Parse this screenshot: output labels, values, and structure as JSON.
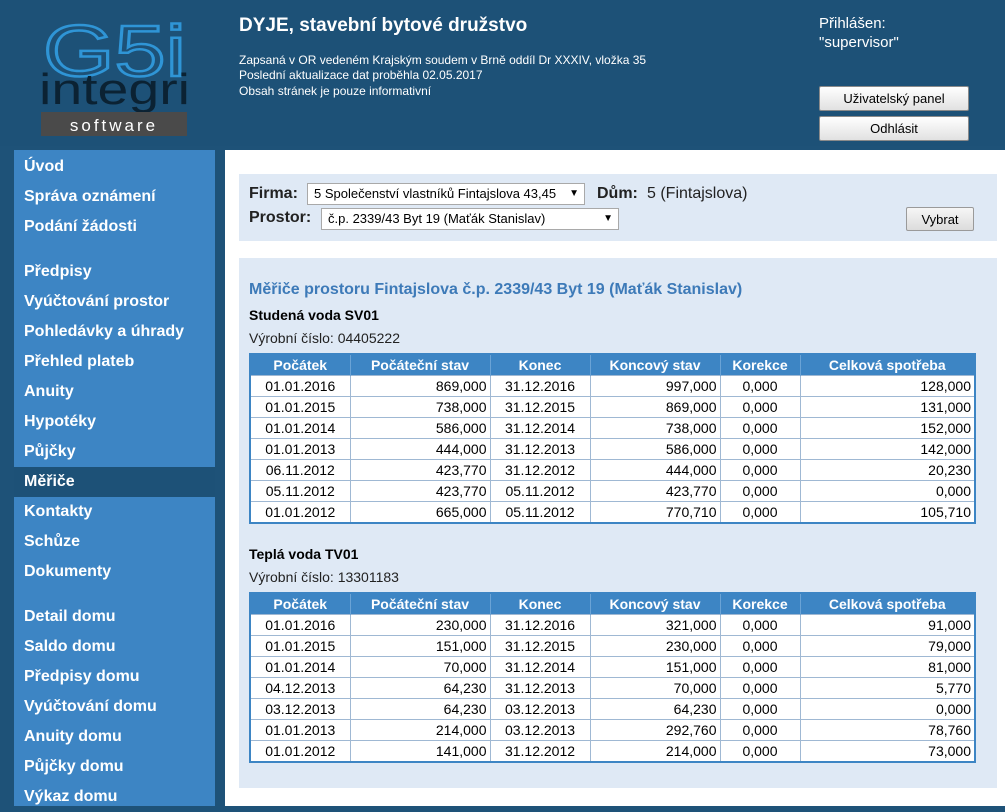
{
  "header": {
    "title": "DYJE, stavební bytové družstvo",
    "lines": [
      "Zapsaná v OR vedeném Krajským soudem v Brně oddíl Dr XXXIV, vložka 35",
      "Poslední aktualizace dat proběhla 02.05.2017",
      "Obsah stránek je pouze informativní"
    ],
    "login_label": "Přihlášen:",
    "login_user": "\"supervisor\"",
    "user_panel_button": "Uživatelský panel",
    "logout_button": "Odhlásit"
  },
  "logo": {
    "main": "G5i",
    "sub": "integri",
    "tag": "software"
  },
  "nav": {
    "items": [
      "Úvod",
      "Správa oznámení",
      "Podání žádosti",
      "Předpisy",
      "Vyúčtování prostor",
      "Pohledávky a úhrady",
      "Přehled plateb",
      "Anuity",
      "Hypotéky",
      "Půjčky",
      "Měřiče",
      "Kontakty",
      "Schůze",
      "Dokumenty",
      "Detail domu",
      "Saldo domu",
      "Předpisy domu",
      "Vyúčtování domu",
      "Anuity domu",
      "Půjčky domu",
      "Výkaz domu"
    ],
    "active": "Měřiče"
  },
  "filter": {
    "firm_label": "Firma:",
    "firm_value": "5 Společenství vlastníků Fintajslova 43,45",
    "house_label": "Dům:",
    "house_value": "5 (Fintajslova)",
    "space_label": "Prostor:",
    "space_value": "č.p. 2339/43 Byt 19 (Maťák Stanislav)",
    "select_button": "Vybrat"
  },
  "meters": {
    "title": "Měřiče prostoru Fintajslova č.p. 2339/43 Byt 19 (Maťák Stanislav)",
    "columns": [
      "Počátek",
      "Počáteční stav",
      "Konec",
      "Koncový stav",
      "Korekce",
      "Celková spotřeba"
    ],
    "list": [
      {
        "name": "Studená voda SV01",
        "serial": "Výrobní číslo: 04405222",
        "rows": [
          [
            "01.01.2016",
            "869,000",
            "31.12.2016",
            "997,000",
            "0,000",
            "128,000"
          ],
          [
            "01.01.2015",
            "738,000",
            "31.12.2015",
            "869,000",
            "0,000",
            "131,000"
          ],
          [
            "01.01.2014",
            "586,000",
            "31.12.2014",
            "738,000",
            "0,000",
            "152,000"
          ],
          [
            "01.01.2013",
            "444,000",
            "31.12.2013",
            "586,000",
            "0,000",
            "142,000"
          ],
          [
            "06.11.2012",
            "423,770",
            "31.12.2012",
            "444,000",
            "0,000",
            "20,230"
          ],
          [
            "05.11.2012",
            "423,770",
            "05.11.2012",
            "423,770",
            "0,000",
            "0,000"
          ],
          [
            "01.01.2012",
            "665,000",
            "05.11.2012",
            "770,710",
            "0,000",
            "105,710"
          ]
        ]
      },
      {
        "name": "Teplá voda TV01",
        "serial": "Výrobní číslo: 13301183",
        "rows": [
          [
            "01.01.2016",
            "230,000",
            "31.12.2016",
            "321,000",
            "0,000",
            "91,000"
          ],
          [
            "01.01.2015",
            "151,000",
            "31.12.2015",
            "230,000",
            "0,000",
            "79,000"
          ],
          [
            "01.01.2014",
            "70,000",
            "31.12.2014",
            "151,000",
            "0,000",
            "81,000"
          ],
          [
            "04.12.2013",
            "64,230",
            "31.12.2013",
            "70,000",
            "0,000",
            "5,770"
          ],
          [
            "03.12.2013",
            "64,230",
            "03.12.2013",
            "64,230",
            "0,000",
            "0,000"
          ],
          [
            "01.01.2013",
            "214,000",
            "03.12.2013",
            "292,760",
            "0,000",
            "78,760"
          ],
          [
            "01.01.2012",
            "141,000",
            "31.12.2012",
            "214,000",
            "0,000",
            "73,000"
          ]
        ]
      }
    ]
  }
}
